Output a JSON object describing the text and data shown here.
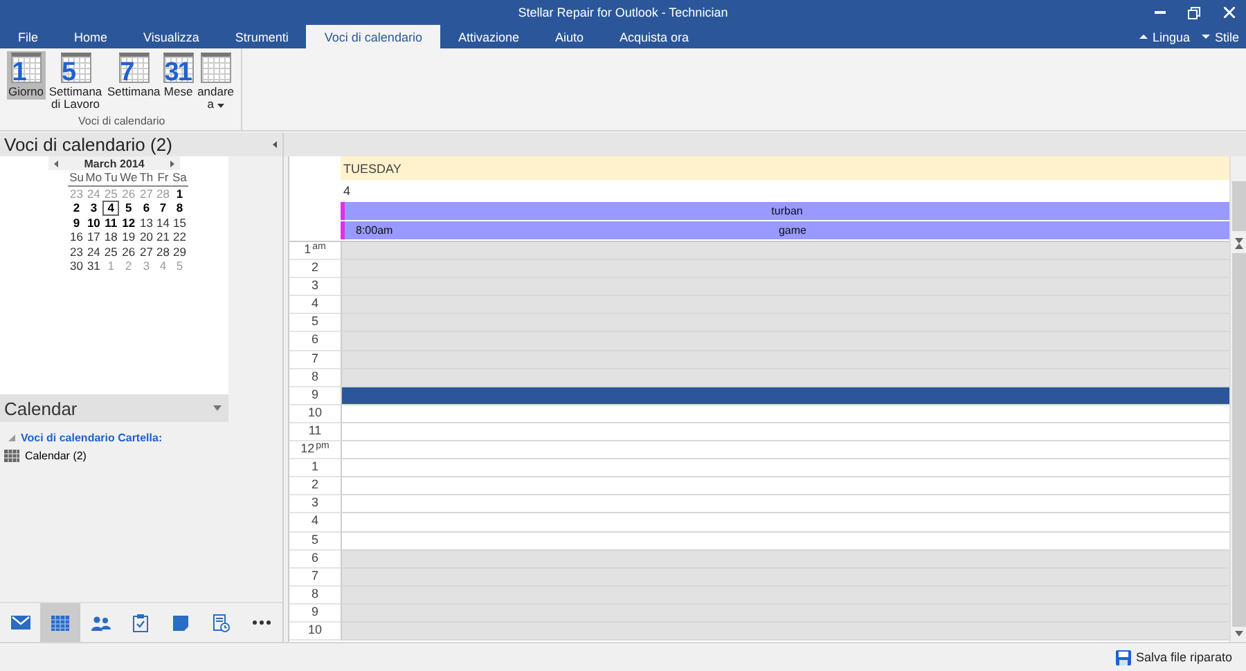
{
  "window": {
    "title": "Stellar Repair for Outlook - Technician"
  },
  "menu_tabs": [
    {
      "label": "File",
      "selected": false
    },
    {
      "label": "Home",
      "selected": false
    },
    {
      "label": "Visualizza",
      "selected": false
    },
    {
      "label": "Strumenti",
      "selected": false
    },
    {
      "label": "Voci di calendario",
      "selected": true
    },
    {
      "label": "Attivazione",
      "selected": false
    },
    {
      "label": "Aiuto",
      "selected": false
    },
    {
      "label": "Acquista ora",
      "selected": false
    }
  ],
  "menu_right": [
    {
      "label": "Lingua",
      "kind": "up"
    },
    {
      "label": "Stile",
      "kind": "down"
    }
  ],
  "ribbon": {
    "group_label": "Voci di calendario",
    "buttons": [
      {
        "label": "Giorno",
        "glyph": "1",
        "selected": true,
        "dropdown": false
      },
      {
        "label": "Settimana di Lavoro",
        "glyph": "5",
        "selected": false,
        "dropdown": false
      },
      {
        "label": "Settimana",
        "glyph": "7",
        "selected": false,
        "dropdown": false
      },
      {
        "label": "Mese",
        "glyph": "31",
        "selected": false,
        "dropdown": false
      },
      {
        "label": "andare a",
        "selected": false,
        "dropdown": true
      }
    ]
  },
  "nav_pane": {
    "title": "Voci di calendario (2)",
    "mini_calendar": {
      "month": "March 2014",
      "weekdays": [
        "Su",
        "Mo",
        "Tu",
        "We",
        "Th",
        "Fr",
        "Sa"
      ],
      "weeks": [
        [
          {
            "day": "23",
            "muted": true,
            "bold": false,
            "selected": false
          },
          {
            "day": "24",
            "muted": true,
            "bold": false,
            "selected": false
          },
          {
            "day": "25",
            "muted": true,
            "bold": false,
            "selected": false
          },
          {
            "day": "26",
            "muted": true,
            "bold": false,
            "selected": false
          },
          {
            "day": "27",
            "muted": true,
            "bold": false,
            "selected": false
          },
          {
            "day": "28",
            "muted": true,
            "bold": false,
            "selected": false
          },
          {
            "day": "1",
            "muted": false,
            "bold": true,
            "selected": false
          }
        ],
        [
          {
            "day": "2",
            "muted": false,
            "bold": true,
            "selected": false
          },
          {
            "day": "3",
            "muted": false,
            "bold": true,
            "selected": false
          },
          {
            "day": "4",
            "muted": false,
            "bold": true,
            "selected": true
          },
          {
            "day": "5",
            "muted": false,
            "bold": true,
            "selected": false
          },
          {
            "day": "6",
            "muted": false,
            "bold": true,
            "selected": false
          },
          {
            "day": "7",
            "muted": false,
            "bold": true,
            "selected": false
          },
          {
            "day": "8",
            "muted": false,
            "bold": true,
            "selected": false
          }
        ],
        [
          {
            "day": "9",
            "muted": false,
            "bold": true,
            "selected": false
          },
          {
            "day": "10",
            "muted": false,
            "bold": true,
            "selected": false
          },
          {
            "day": "11",
            "muted": false,
            "bold": true,
            "selected": false
          },
          {
            "day": "12",
            "muted": false,
            "bold": true,
            "selected": false
          },
          {
            "day": "13",
            "muted": false,
            "bold": false,
            "selected": false
          },
          {
            "day": "14",
            "muted": false,
            "bold": false,
            "selected": false
          },
          {
            "day": "15",
            "muted": false,
            "bold": false,
            "selected": false
          }
        ],
        [
          {
            "day": "16",
            "muted": false,
            "bold": false,
            "selected": false
          },
          {
            "day": "17",
            "muted": false,
            "bold": false,
            "selected": false
          },
          {
            "day": "18",
            "muted": false,
            "bold": false,
            "selected": false
          },
          {
            "day": "19",
            "muted": false,
            "bold": false,
            "selected": false
          },
          {
            "day": "20",
            "muted": false,
            "bold": false,
            "selected": false
          },
          {
            "day": "21",
            "muted": false,
            "bold": false,
            "selected": false
          },
          {
            "day": "22",
            "muted": false,
            "bold": false,
            "selected": false
          }
        ],
        [
          {
            "day": "23",
            "muted": false,
            "bold": false,
            "selected": false
          },
          {
            "day": "24",
            "muted": false,
            "bold": false,
            "selected": false
          },
          {
            "day": "25",
            "muted": false,
            "bold": false,
            "selected": false
          },
          {
            "day": "26",
            "muted": false,
            "bold": false,
            "selected": false
          },
          {
            "day": "27",
            "muted": false,
            "bold": false,
            "selected": false
          },
          {
            "day": "28",
            "muted": false,
            "bold": false,
            "selected": false
          },
          {
            "day": "29",
            "muted": false,
            "bold": false,
            "selected": false
          }
        ],
        [
          {
            "day": "30",
            "muted": false,
            "bold": false,
            "selected": false
          },
          {
            "day": "31",
            "muted": false,
            "bold": false,
            "selected": false
          },
          {
            "day": "1",
            "muted": true,
            "bold": false,
            "selected": false
          },
          {
            "day": "2",
            "muted": true,
            "bold": false,
            "selected": false
          },
          {
            "day": "3",
            "muted": true,
            "bold": false,
            "selected": false
          },
          {
            "day": "4",
            "muted": true,
            "bold": false,
            "selected": false
          },
          {
            "day": "5",
            "muted": true,
            "bold": false,
            "selected": false
          }
        ]
      ]
    },
    "folder_header": "Calendar",
    "folder_tree": {
      "label": "Voci di calendario Cartella:",
      "expanded": true,
      "children": [
        {
          "label": "Calendar (2)"
        }
      ]
    },
    "nav_buttons": [
      {
        "kind": "mail",
        "selected": false
      },
      {
        "kind": "calendar",
        "selected": true
      },
      {
        "kind": "people",
        "selected": false
      },
      {
        "kind": "tasks",
        "selected": false
      },
      {
        "kind": "notes",
        "selected": false
      },
      {
        "kind": "journal",
        "selected": false
      },
      {
        "kind": "more",
        "selected": false
      }
    ]
  },
  "day_view": {
    "day_name": "TUESDAY",
    "date": "4",
    "events": [
      {
        "title": "turban"
      },
      {
        "time": "8:00am",
        "title": "game"
      }
    ],
    "hours": [
      {
        "label": "1",
        "suffix": "am",
        "working": false,
        "selected": false
      },
      {
        "label": "2",
        "working": false,
        "selected": false
      },
      {
        "label": "3",
        "working": false,
        "selected": false
      },
      {
        "label": "4",
        "working": false,
        "selected": false
      },
      {
        "label": "5",
        "working": false,
        "selected": false
      },
      {
        "label": "6",
        "working": false,
        "selected": false
      },
      {
        "label": "7",
        "working": false,
        "selected": false
      },
      {
        "label": "8",
        "working": false,
        "selected": false
      },
      {
        "label": "9",
        "selected": true
      },
      {
        "label": "10",
        "working": true,
        "selected": false
      },
      {
        "label": "11",
        "working": true,
        "selected": false
      },
      {
        "label": "12",
        "suffix": "pm",
        "working": true,
        "selected": false
      },
      {
        "label": "1",
        "working": true,
        "selected": false
      },
      {
        "label": "2",
        "working": true,
        "selected": false
      },
      {
        "label": "3",
        "working": true,
        "selected": false
      },
      {
        "label": "4",
        "working": true,
        "selected": false
      },
      {
        "label": "5",
        "working": true,
        "selected": false
      },
      {
        "label": "6",
        "working": false,
        "selected": false
      },
      {
        "label": "7",
        "working": false,
        "selected": false
      },
      {
        "label": "8",
        "working": false,
        "selected": false
      },
      {
        "label": "9",
        "working": false,
        "selected": false
      },
      {
        "label": "10",
        "working": false,
        "selected": false
      }
    ]
  },
  "status_bar": {
    "save_button": "Salva file riparato"
  }
}
